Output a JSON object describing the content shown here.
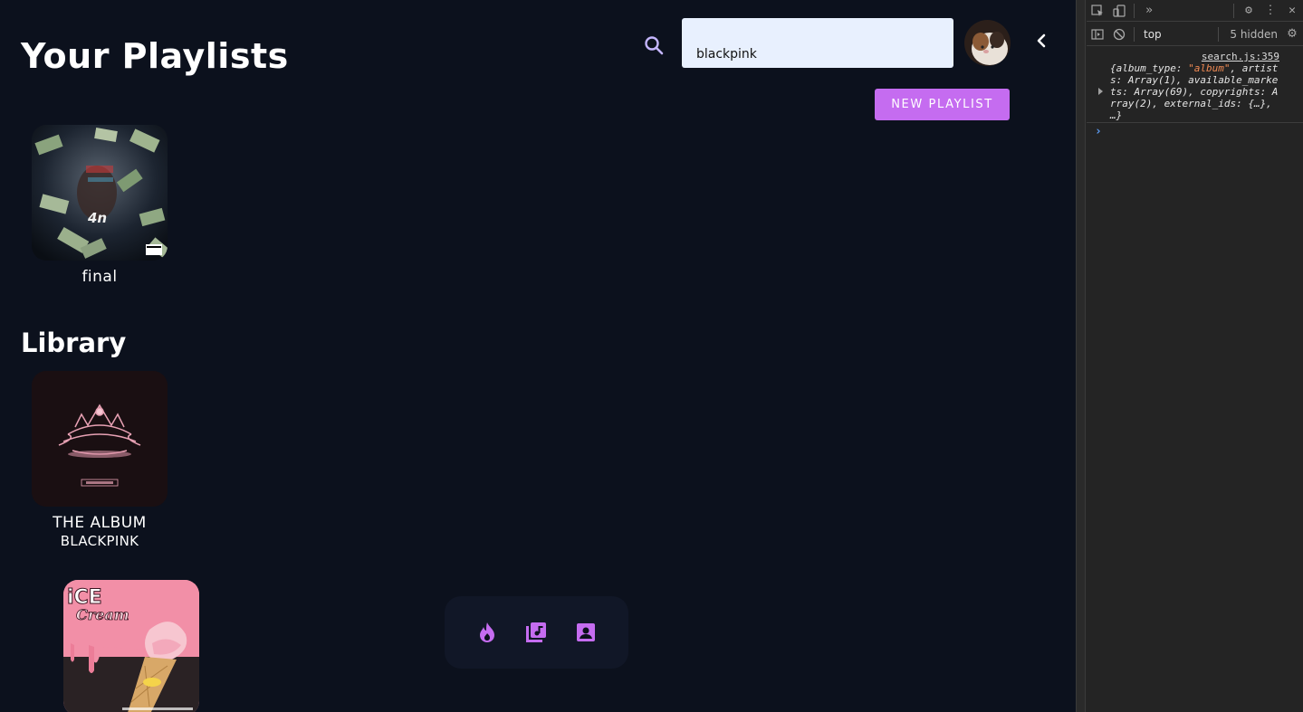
{
  "app": {
    "title": "Your Playlists",
    "search": {
      "value": "blackpink",
      "placeholder": ""
    },
    "new_playlist_label": "NEW PLAYLIST",
    "playlists": [
      {
        "name": "final"
      }
    ],
    "library_title": "Library",
    "library": [
      {
        "name": "THE ALBUM",
        "artist": "BLACKPINK"
      },
      {
        "name": "",
        "artist": ""
      }
    ],
    "nav": {
      "items": [
        "trending-icon",
        "library-icon",
        "profile-icon"
      ]
    },
    "accent": "#c56cf0",
    "background": "#0c111d"
  },
  "devtools": {
    "context": "top",
    "hidden_count": "5 hidden",
    "log_source": "search.js:359",
    "log": {
      "prefix": "{album_type: ",
      "string": "\"album\"",
      "rest": ", artists: Array(1), available_markets: Array(69), copyrights: Array(2), external_ids: {…}, …}"
    }
  }
}
